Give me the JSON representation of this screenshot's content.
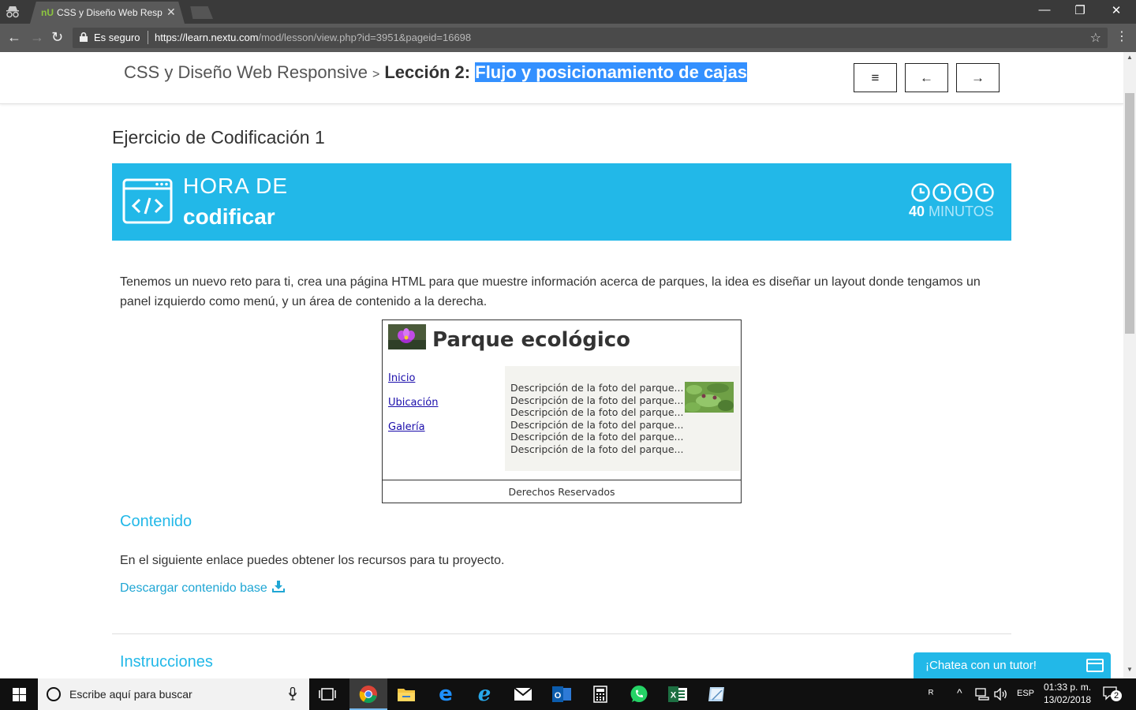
{
  "browser": {
    "tab_title": "CSS y Diseño Web Responsive",
    "tab_favicon": "nU",
    "secure_label": "Es seguro",
    "url_scheme": "https://",
    "url_host": "learn.nextu.com",
    "url_path": "/mod/lesson/view.php?id=3951&pageid=16698"
  },
  "header": {
    "course": "CSS y Diseño Web Responsive",
    "separator": ">",
    "lesson_label": "Lección 2:",
    "lesson_title": "Flujo y posicionamiento de cajas",
    "buttons": [
      "menu-icon",
      "arrow-left-icon",
      "arrow-right-icon"
    ]
  },
  "exercise": {
    "title": "Ejercicio de Codificación 1",
    "banner_line1": "HORA DE",
    "banner_line2": "codificar",
    "minutes_num": "40",
    "minutes_label": "MINUTOS",
    "accent_color": "#22b8e8"
  },
  "intro": "Tenemos un nuevo reto para ti, crea una página HTML para que muestre información acerca de parques, la idea es diseñar un layout donde tengamos un panel izquierdo como menú, y un área de contenido a la derecha.",
  "preview": {
    "title": "Parque ecológico",
    "nav": [
      "Inicio",
      "Ubicación",
      "Galería"
    ],
    "descriptions": [
      "Descripción de la foto del parque...",
      "Descripción de la foto del parque...",
      "Descripción de la foto del parque...",
      "Descripción de la foto del parque...",
      "Descripción de la foto del parque...",
      "Descripción de la foto del parque..."
    ],
    "footer": "Derechos Reservados"
  },
  "contenido": {
    "heading": "Contenido",
    "text": "En el siguiente enlace puedes obtener los recursos para tu proyecto.",
    "link": "Descargar contenido base"
  },
  "instrucciones": {
    "heading": "Instrucciones"
  },
  "chat": {
    "label": "¡Chatea con un tutor!"
  },
  "taskbar": {
    "search_placeholder": "Escribe aquí para buscar",
    "lang": "ESP",
    "time": "01:33 p. m.",
    "date": "13/02/2018",
    "notifications": "2"
  }
}
